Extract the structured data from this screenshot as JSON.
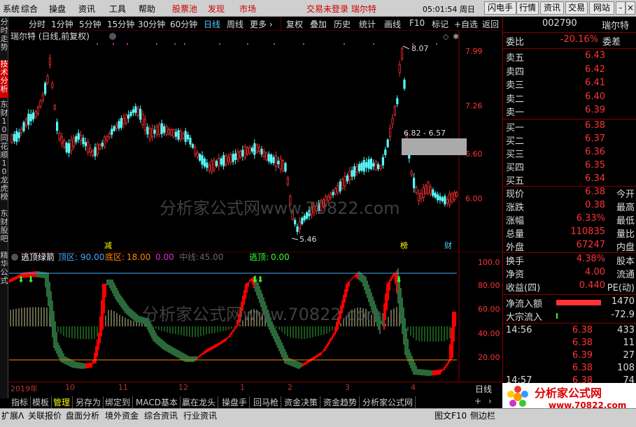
{
  "menubar": {
    "items": [
      "系统",
      "综合",
      "操盘",
      "资讯",
      "工具",
      "帮助"
    ],
    "highlight_items": [
      "股票池",
      "发现",
      "市场"
    ],
    "login_status": "交易未登录 瑞尔特",
    "clock": "05:01:54 周日",
    "buttons": [
      "闪电手",
      "行情",
      "资讯",
      "交易",
      "网站"
    ],
    "window_controls": [
      "-",
      "□",
      "×"
    ]
  },
  "left_strip": [
    "分时走势",
    "技术分析",
    "东财10",
    "同花顺10",
    "龙虎榜",
    "东财股吧",
    "精华公式"
  ],
  "period_bar": {
    "periods": [
      "分时",
      "1分钟",
      "5分钟",
      "15分钟",
      "30分钟",
      "60分钟",
      "日线",
      "周线",
      "更多 ›"
    ],
    "selected": "日线",
    "tools": [
      "复权",
      "叠加",
      "历史",
      "统计",
      "画线",
      "F10",
      "标记",
      "+自选",
      "返回"
    ]
  },
  "chart": {
    "title": "瑞尔特 (日线,前复权)",
    "price_labels": [
      "7.99",
      "7.26",
      "6.60",
      "6.00"
    ],
    "high_label": "8.07",
    "low_label": "5.46",
    "range_box_label": "6.82 - 6.57",
    "event_markers": [
      "减",
      "榜",
      "财"
    ],
    "watermark": "分析家公式网www.70822.com",
    "colors": {
      "up": "#ff3232",
      "down": "#54fcfc",
      "axis": "#800000"
    }
  },
  "indicator": {
    "name": "逃顶绿箭",
    "params": [
      {
        "label": "顶区:",
        "value": "90.00",
        "color": "#4af"
      },
      {
        "label": "底区:",
        "value": "18.00",
        "color": "#f80"
      },
      {
        "label": "",
        "value": "0.00",
        "color": "#c3c"
      },
      {
        "label": "中线:",
        "value": "45.00",
        "color": "#666"
      },
      {
        "label": "逃顶:",
        "value": "0.00",
        "color": "#3f3"
      }
    ],
    "y_labels": [
      "100.0",
      "80.00",
      "60.00",
      "40.00",
      "20.00"
    ],
    "watermark": "分析家公式网www.70822.com"
  },
  "x_axis": [
    "2019年",
    "10",
    "11",
    "12",
    "1",
    "2",
    "3",
    "4"
  ],
  "x_axis_right": "日线",
  "bottom_tabs": [
    "指标",
    "模板",
    "管理",
    "另存为",
    "绑定到",
    "MACD基本",
    "赢在龙头",
    "操盘手",
    "回马枪",
    "资金决策",
    "资金趋势",
    "分析家公式网"
  ],
  "bottom_tab_selected": "管理",
  "statusbar": [
    "扩展Λ",
    "关联报价",
    "盘面分析",
    "境外资金",
    "综合资讯",
    "行业资讯"
  ],
  "statusbar_right": [
    "图文F10",
    "侧边栏"
  ],
  "quote": {
    "code": "002790",
    "name": "瑞尔特",
    "weibi_label": "委比",
    "weibi": "-20.16%",
    "weicha_label": "委差",
    "asks": [
      {
        "label": "卖五",
        "price": "6.43"
      },
      {
        "label": "卖四",
        "price": "6.42"
      },
      {
        "label": "卖三",
        "price": "6.41"
      },
      {
        "label": "卖二",
        "price": "6.40"
      },
      {
        "label": "卖一",
        "price": "6.39"
      }
    ],
    "bids": [
      {
        "label": "买一",
        "price": "6.38"
      },
      {
        "label": "买二",
        "price": "6.37"
      },
      {
        "label": "买三",
        "price": "6.36"
      },
      {
        "label": "买四",
        "price": "6.35"
      },
      {
        "label": "买五",
        "price": "6.34"
      }
    ],
    "stats": [
      {
        "label": "现价",
        "value": "6.38",
        "right": "今开"
      },
      {
        "label": "涨跌",
        "value": "0.38",
        "right": "最高"
      },
      {
        "label": "涨幅",
        "value": "6.33%",
        "right": "最低"
      },
      {
        "label": "总量",
        "value": "110835",
        "right": "量比"
      },
      {
        "label": "外盘",
        "value": "67247",
        "right": "内盘"
      }
    ],
    "stats2": [
      {
        "label": "换手",
        "value": "4.38%",
        "right": "股本"
      },
      {
        "label": "净资",
        "value": "4.00",
        "right": "流通"
      },
      {
        "label": "收益(四)",
        "value": "0.440",
        "right": "PE(动)"
      }
    ],
    "flows": [
      {
        "label": "净流入额",
        "value": "1470"
      },
      {
        "label": "大宗流入",
        "value": "-72.9"
      }
    ],
    "ticks": [
      {
        "time": "14:56",
        "price": "6.38",
        "vol": "433"
      },
      {
        "time": "",
        "price": "6.38",
        "vol": "11"
      },
      {
        "time": "",
        "price": "6.39",
        "vol": "27"
      },
      {
        "time": "",
        "price": "6.38",
        "vol": "108"
      },
      {
        "time": "14:57",
        "price": "6.38",
        "vol": "74"
      }
    ]
  },
  "logo": {
    "text": "分析家公式网",
    "url_text": "www.70822.com"
  }
}
